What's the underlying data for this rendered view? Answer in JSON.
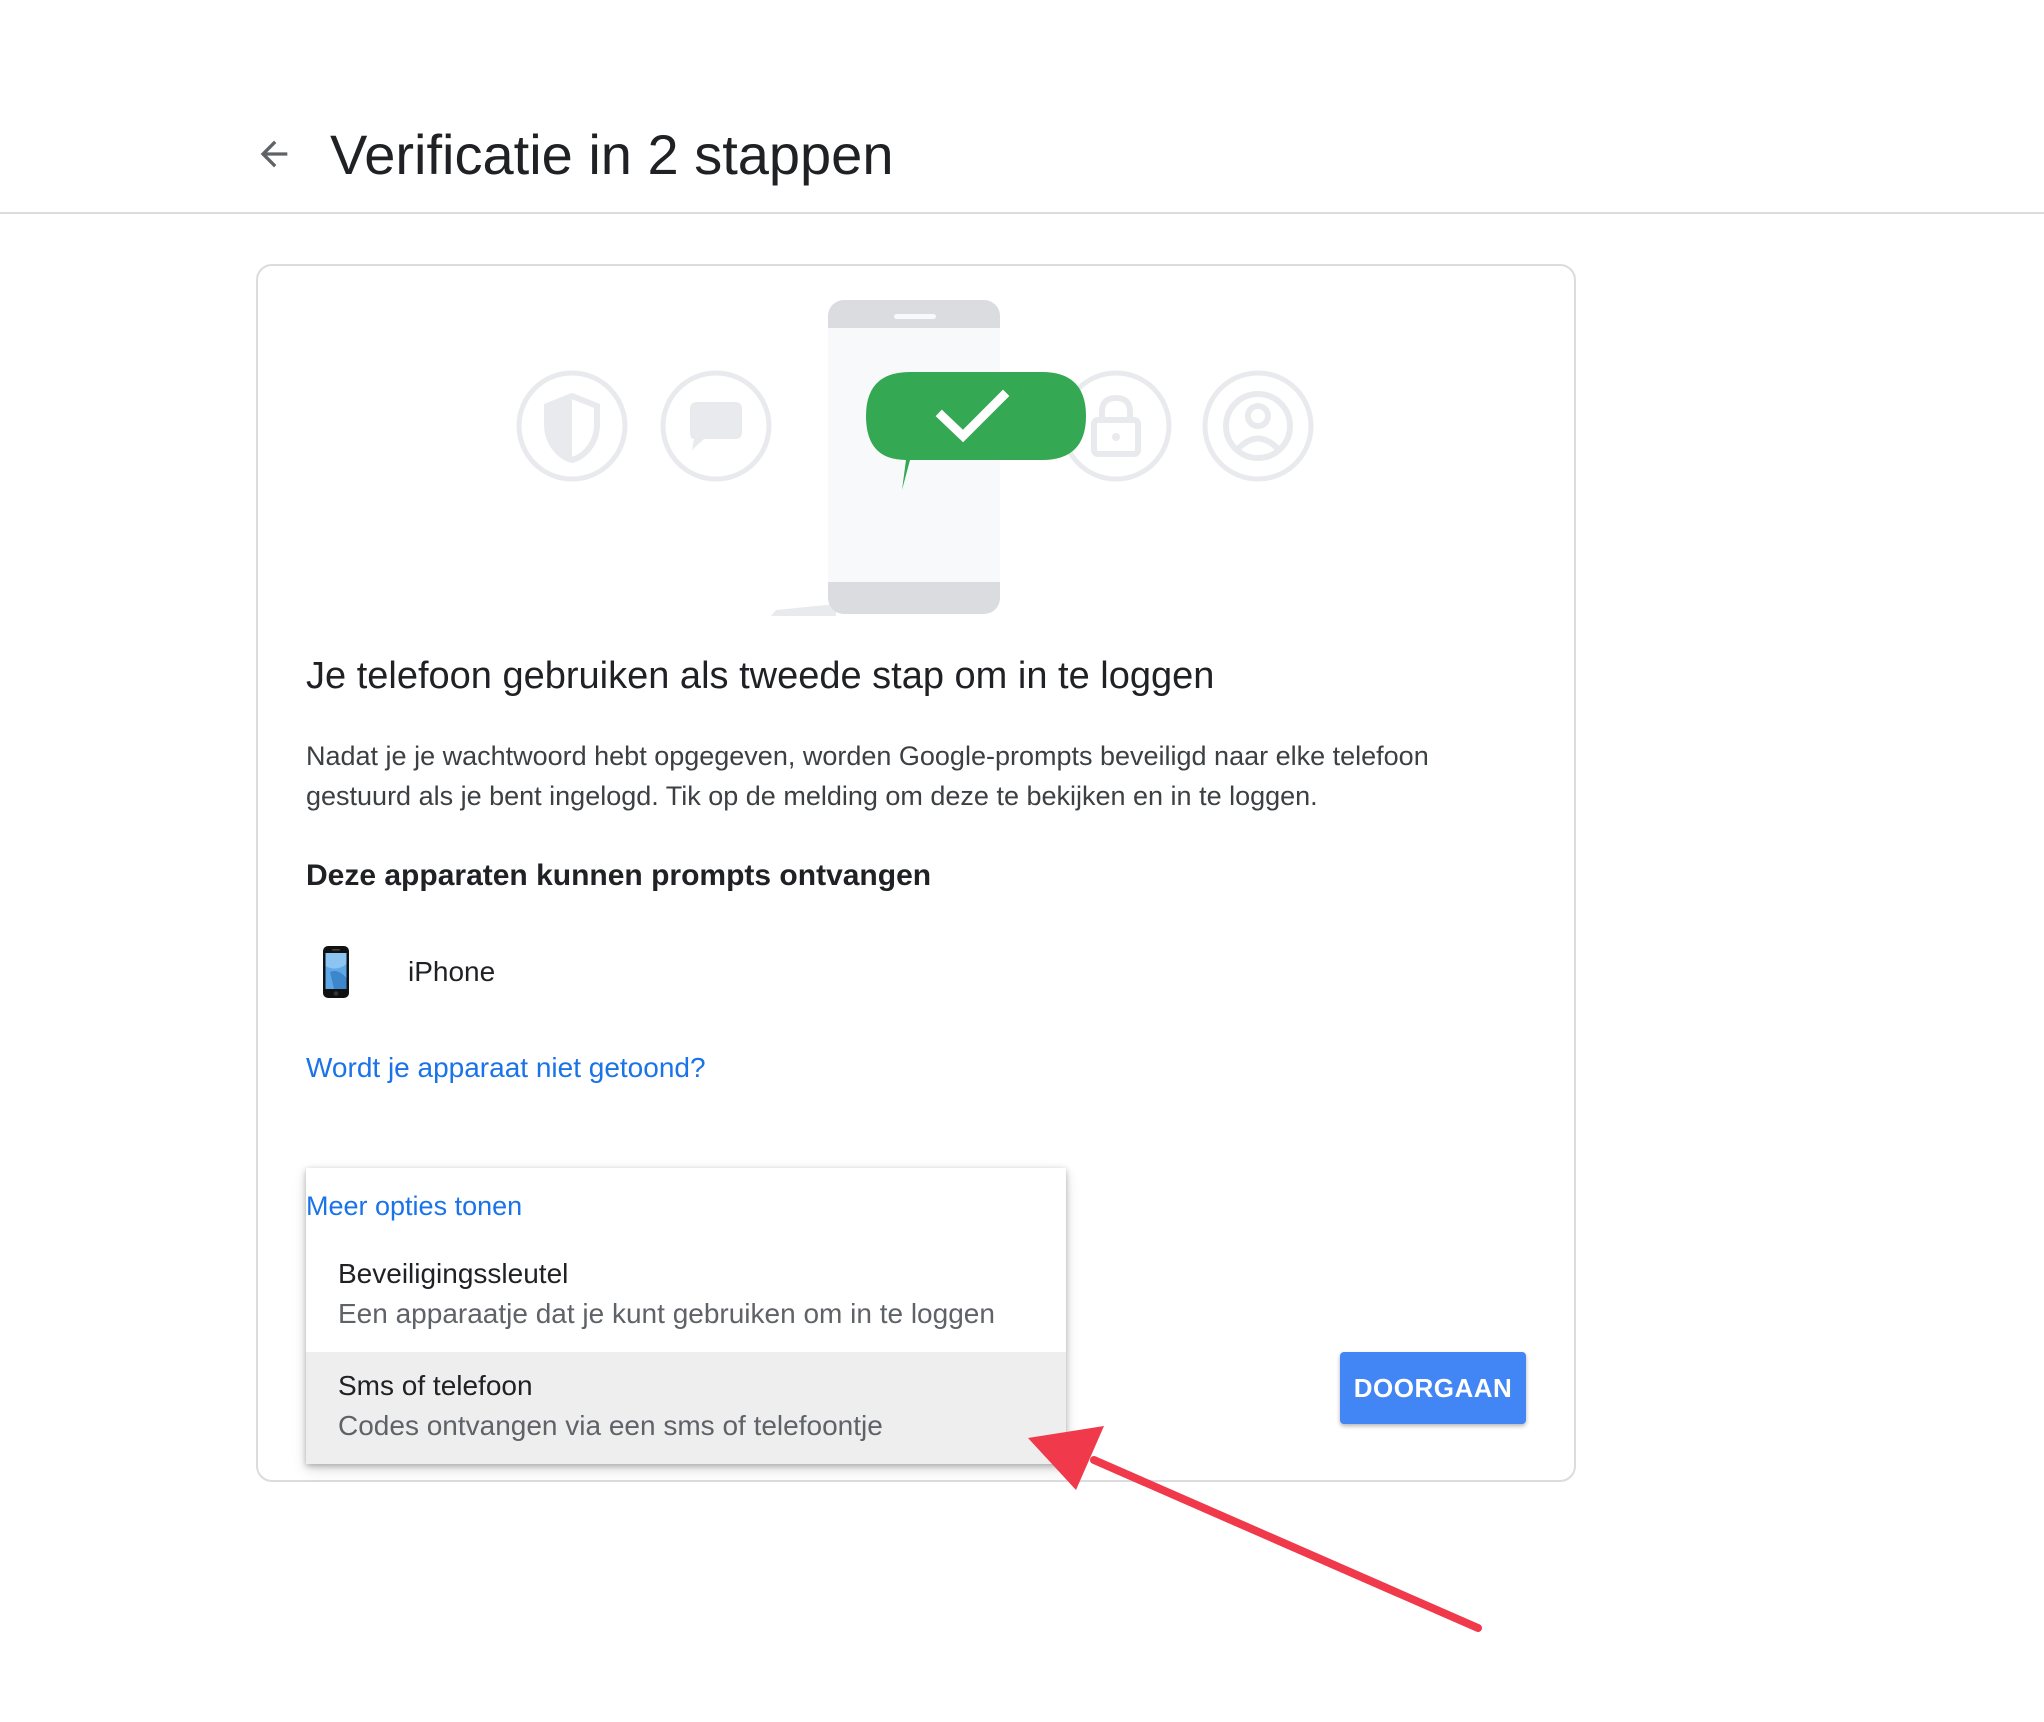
{
  "header": {
    "back_icon": "arrow-back-icon",
    "title": "Verificatie in 2 stappen"
  },
  "illustration": {
    "icons": [
      "shield-icon",
      "chat-bubble-icon",
      "phone-icon",
      "checkmark-icon",
      "lock-icon",
      "account-icon"
    ],
    "accent_color": "#34a853"
  },
  "card": {
    "heading": "Je telefoon gebruiken als tweede stap om in te loggen",
    "description": "Nadat je je wachtwoord hebt opgegeven, worden Google-prompts beveiligd naar elke telefoon gestuurd als je bent ingelogd. Tik op de melding om deze te bekijken en in te loggen.",
    "devices_heading": "Deze apparaten kunnen prompts ontvangen",
    "devices": [
      {
        "icon": "iphone-icon",
        "name": "iPhone"
      }
    ],
    "device_missing_link": "Wordt je apparaat niet getoond?"
  },
  "more_options": {
    "toggle_label": "Meer opties tonen",
    "options": [
      {
        "title": "Beveiligingssleutel",
        "subtitle": "Een apparaatje dat je kunt gebruiken om in te loggen",
        "highlighted": false
      },
      {
        "title": "Sms of telefoon",
        "subtitle": "Codes ontvangen via een sms of telefoontje",
        "highlighted": true
      }
    ]
  },
  "actions": {
    "continue_label": "DOORGAAN",
    "continue_color": "#4285f4"
  },
  "annotation": {
    "arrow_color": "#f0394a"
  },
  "colors": {
    "link": "#1a73e8",
    "divider": "#dadce0",
    "highlight": "#eeeeee"
  }
}
